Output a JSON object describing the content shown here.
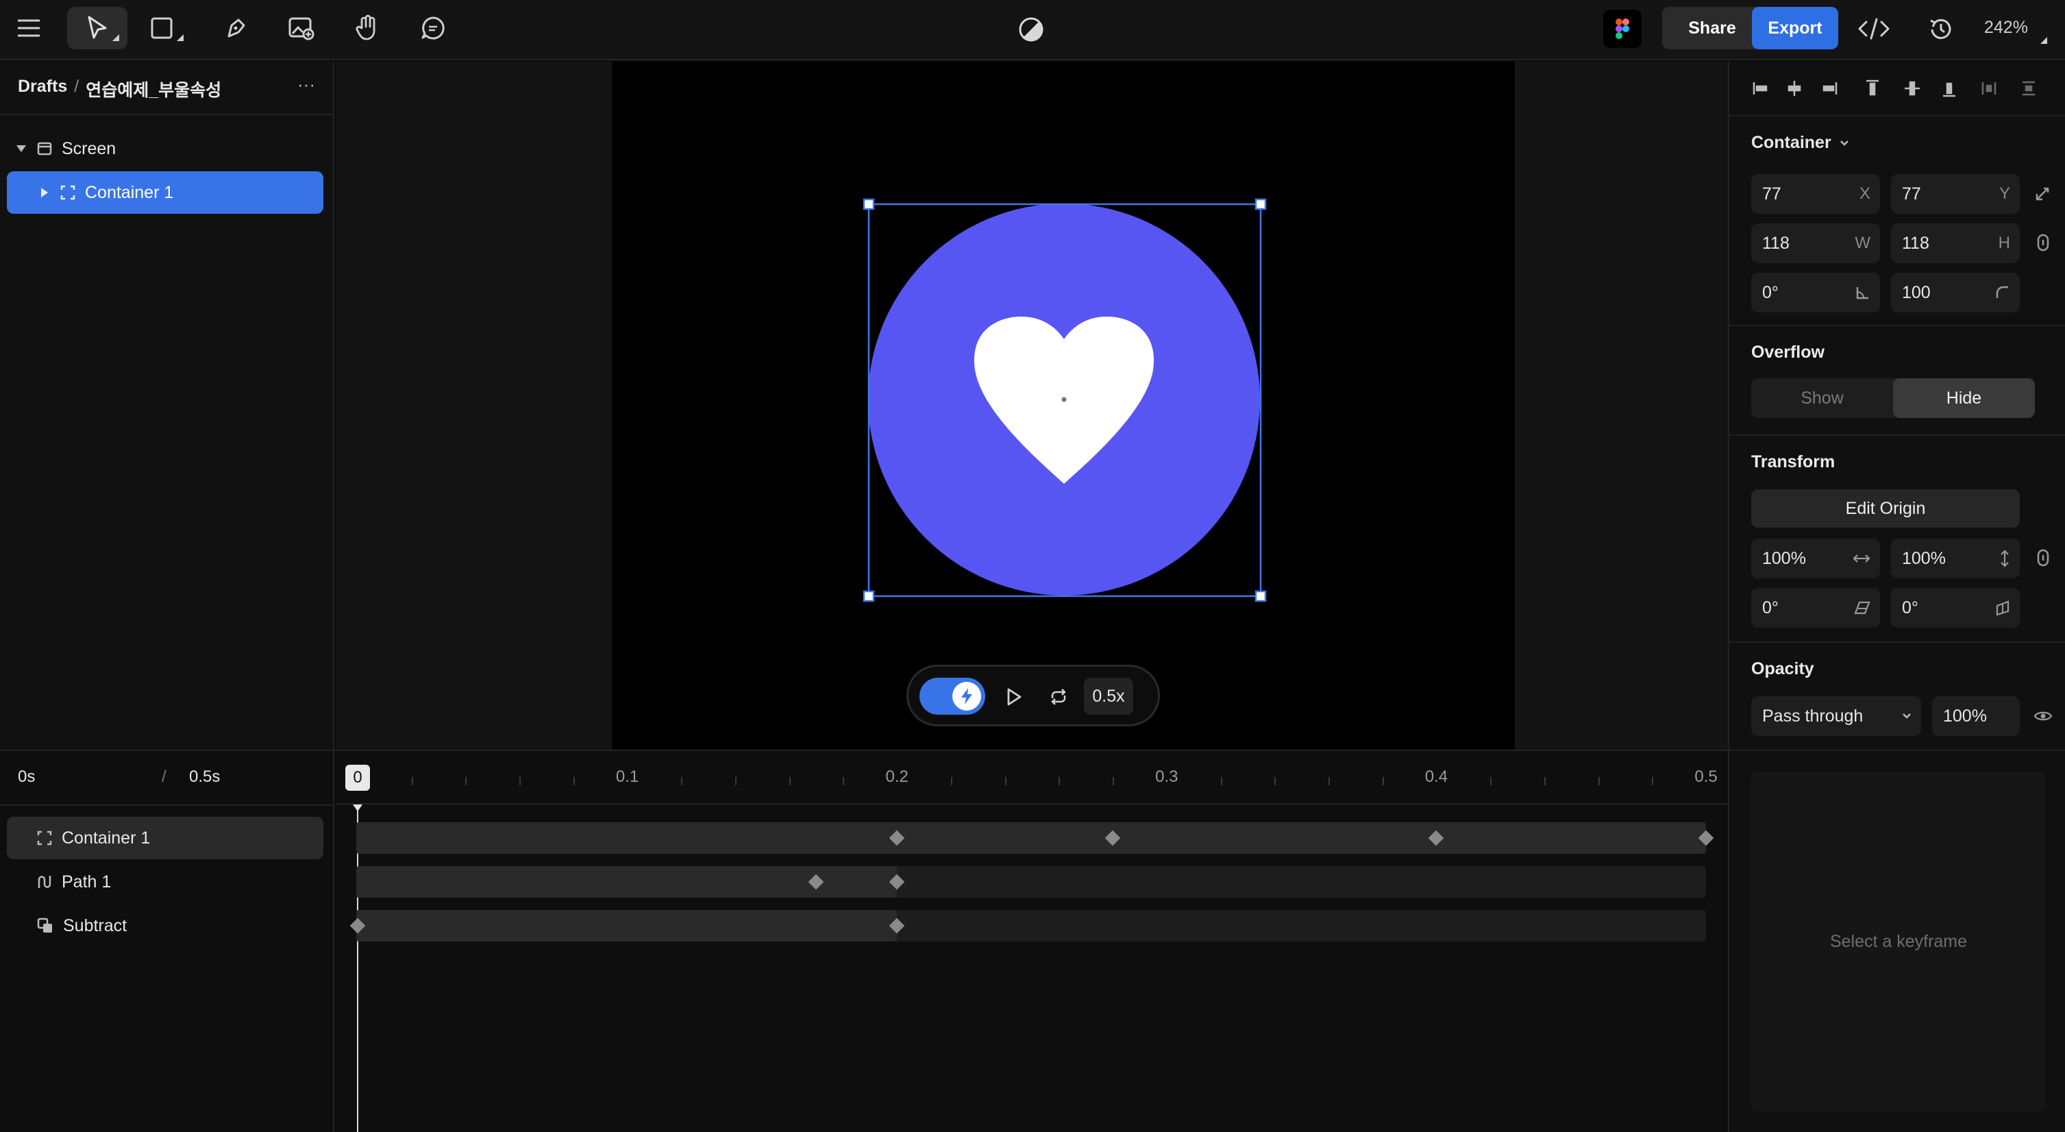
{
  "toolbar": {
    "share_label": "Share",
    "export_label": "Export",
    "zoom": "242%",
    "accent": "#2f6fe4"
  },
  "left_panel": {
    "breadcrumb_root": "Drafts",
    "breadcrumb_sep": "/",
    "breadcrumb_file": "연습예제_부울속성",
    "more": "···",
    "layers": [
      {
        "label": "Screen",
        "icon": "screen-icon"
      },
      {
        "label": "Container 1",
        "icon": "container-icon",
        "selected": true
      }
    ]
  },
  "canvas": {
    "circle_color": "#5856f2",
    "playback_speed": "0.5x"
  },
  "properties": {
    "type_label": "Container",
    "x": {
      "value": "77",
      "label": "X"
    },
    "y": {
      "value": "77",
      "label": "Y"
    },
    "w": {
      "value": "118",
      "label": "W"
    },
    "h": {
      "value": "118",
      "label": "H"
    },
    "rotation": "0°",
    "radius": "100",
    "overflow_title": "Overflow",
    "overflow_show": "Show",
    "overflow_hide": "Hide",
    "transform_title": "Transform",
    "edit_origin": "Edit Origin",
    "scale_x": "100%",
    "scale_y": "100%",
    "skew_x": "0°",
    "skew_y": "0°",
    "opacity_title": "Opacity",
    "blend_mode": "Pass through",
    "opacity_value": "100%",
    "keyframe_hint": "Select a keyframe"
  },
  "timeline": {
    "current_time": "0s",
    "separator": "/",
    "duration": "0.5s",
    "playhead_label": "0",
    "ticks": [
      "0.1",
      "0.2",
      "0.3",
      "0.4",
      "0.5"
    ],
    "tracks": [
      {
        "label": "Container 1",
        "icon": "container-icon",
        "keyframes": [
          0.2,
          0.28,
          0.4,
          0.5
        ],
        "fill_to": 0.5
      },
      {
        "label": "Path 1",
        "icon": "path-icon",
        "keyframes": [
          0.17,
          0.2
        ],
        "fill_to": 0.2
      },
      {
        "label": "Subtract",
        "icon": "subtract-icon",
        "keyframes": [
          0,
          0.2
        ],
        "fill_to": 0.2
      }
    ]
  }
}
